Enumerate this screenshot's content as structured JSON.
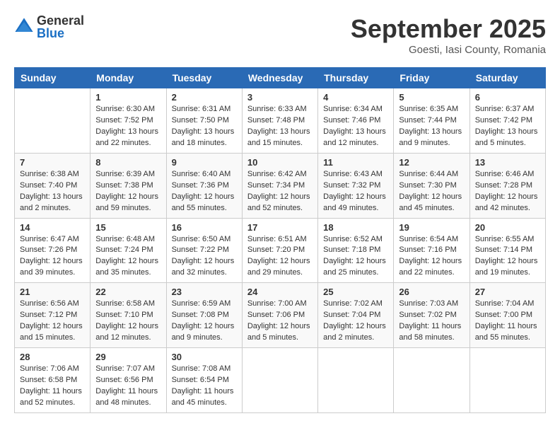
{
  "logo": {
    "general": "General",
    "blue": "Blue"
  },
  "title": "September 2025",
  "location": "Goesti, Iasi County, Romania",
  "days_of_week": [
    "Sunday",
    "Monday",
    "Tuesday",
    "Wednesday",
    "Thursday",
    "Friday",
    "Saturday"
  ],
  "weeks": [
    [
      {
        "day": "",
        "info": ""
      },
      {
        "day": "1",
        "info": "Sunrise: 6:30 AM\nSunset: 7:52 PM\nDaylight: 13 hours\nand 22 minutes."
      },
      {
        "day": "2",
        "info": "Sunrise: 6:31 AM\nSunset: 7:50 PM\nDaylight: 13 hours\nand 18 minutes."
      },
      {
        "day": "3",
        "info": "Sunrise: 6:33 AM\nSunset: 7:48 PM\nDaylight: 13 hours\nand 15 minutes."
      },
      {
        "day": "4",
        "info": "Sunrise: 6:34 AM\nSunset: 7:46 PM\nDaylight: 13 hours\nand 12 minutes."
      },
      {
        "day": "5",
        "info": "Sunrise: 6:35 AM\nSunset: 7:44 PM\nDaylight: 13 hours\nand 9 minutes."
      },
      {
        "day": "6",
        "info": "Sunrise: 6:37 AM\nSunset: 7:42 PM\nDaylight: 13 hours\nand 5 minutes."
      }
    ],
    [
      {
        "day": "7",
        "info": "Sunrise: 6:38 AM\nSunset: 7:40 PM\nDaylight: 13 hours\nand 2 minutes."
      },
      {
        "day": "8",
        "info": "Sunrise: 6:39 AM\nSunset: 7:38 PM\nDaylight: 12 hours\nand 59 minutes."
      },
      {
        "day": "9",
        "info": "Sunrise: 6:40 AM\nSunset: 7:36 PM\nDaylight: 12 hours\nand 55 minutes."
      },
      {
        "day": "10",
        "info": "Sunrise: 6:42 AM\nSunset: 7:34 PM\nDaylight: 12 hours\nand 52 minutes."
      },
      {
        "day": "11",
        "info": "Sunrise: 6:43 AM\nSunset: 7:32 PM\nDaylight: 12 hours\nand 49 minutes."
      },
      {
        "day": "12",
        "info": "Sunrise: 6:44 AM\nSunset: 7:30 PM\nDaylight: 12 hours\nand 45 minutes."
      },
      {
        "day": "13",
        "info": "Sunrise: 6:46 AM\nSunset: 7:28 PM\nDaylight: 12 hours\nand 42 minutes."
      }
    ],
    [
      {
        "day": "14",
        "info": "Sunrise: 6:47 AM\nSunset: 7:26 PM\nDaylight: 12 hours\nand 39 minutes."
      },
      {
        "day": "15",
        "info": "Sunrise: 6:48 AM\nSunset: 7:24 PM\nDaylight: 12 hours\nand 35 minutes."
      },
      {
        "day": "16",
        "info": "Sunrise: 6:50 AM\nSunset: 7:22 PM\nDaylight: 12 hours\nand 32 minutes."
      },
      {
        "day": "17",
        "info": "Sunrise: 6:51 AM\nSunset: 7:20 PM\nDaylight: 12 hours\nand 29 minutes."
      },
      {
        "day": "18",
        "info": "Sunrise: 6:52 AM\nSunset: 7:18 PM\nDaylight: 12 hours\nand 25 minutes."
      },
      {
        "day": "19",
        "info": "Sunrise: 6:54 AM\nSunset: 7:16 PM\nDaylight: 12 hours\nand 22 minutes."
      },
      {
        "day": "20",
        "info": "Sunrise: 6:55 AM\nSunset: 7:14 PM\nDaylight: 12 hours\nand 19 minutes."
      }
    ],
    [
      {
        "day": "21",
        "info": "Sunrise: 6:56 AM\nSunset: 7:12 PM\nDaylight: 12 hours\nand 15 minutes."
      },
      {
        "day": "22",
        "info": "Sunrise: 6:58 AM\nSunset: 7:10 PM\nDaylight: 12 hours\nand 12 minutes."
      },
      {
        "day": "23",
        "info": "Sunrise: 6:59 AM\nSunset: 7:08 PM\nDaylight: 12 hours\nand 9 minutes."
      },
      {
        "day": "24",
        "info": "Sunrise: 7:00 AM\nSunset: 7:06 PM\nDaylight: 12 hours\nand 5 minutes."
      },
      {
        "day": "25",
        "info": "Sunrise: 7:02 AM\nSunset: 7:04 PM\nDaylight: 12 hours\nand 2 minutes."
      },
      {
        "day": "26",
        "info": "Sunrise: 7:03 AM\nSunset: 7:02 PM\nDaylight: 11 hours\nand 58 minutes."
      },
      {
        "day": "27",
        "info": "Sunrise: 7:04 AM\nSunset: 7:00 PM\nDaylight: 11 hours\nand 55 minutes."
      }
    ],
    [
      {
        "day": "28",
        "info": "Sunrise: 7:06 AM\nSunset: 6:58 PM\nDaylight: 11 hours\nand 52 minutes."
      },
      {
        "day": "29",
        "info": "Sunrise: 7:07 AM\nSunset: 6:56 PM\nDaylight: 11 hours\nand 48 minutes."
      },
      {
        "day": "30",
        "info": "Sunrise: 7:08 AM\nSunset: 6:54 PM\nDaylight: 11 hours\nand 45 minutes."
      },
      {
        "day": "",
        "info": ""
      },
      {
        "day": "",
        "info": ""
      },
      {
        "day": "",
        "info": ""
      },
      {
        "day": "",
        "info": ""
      }
    ]
  ]
}
